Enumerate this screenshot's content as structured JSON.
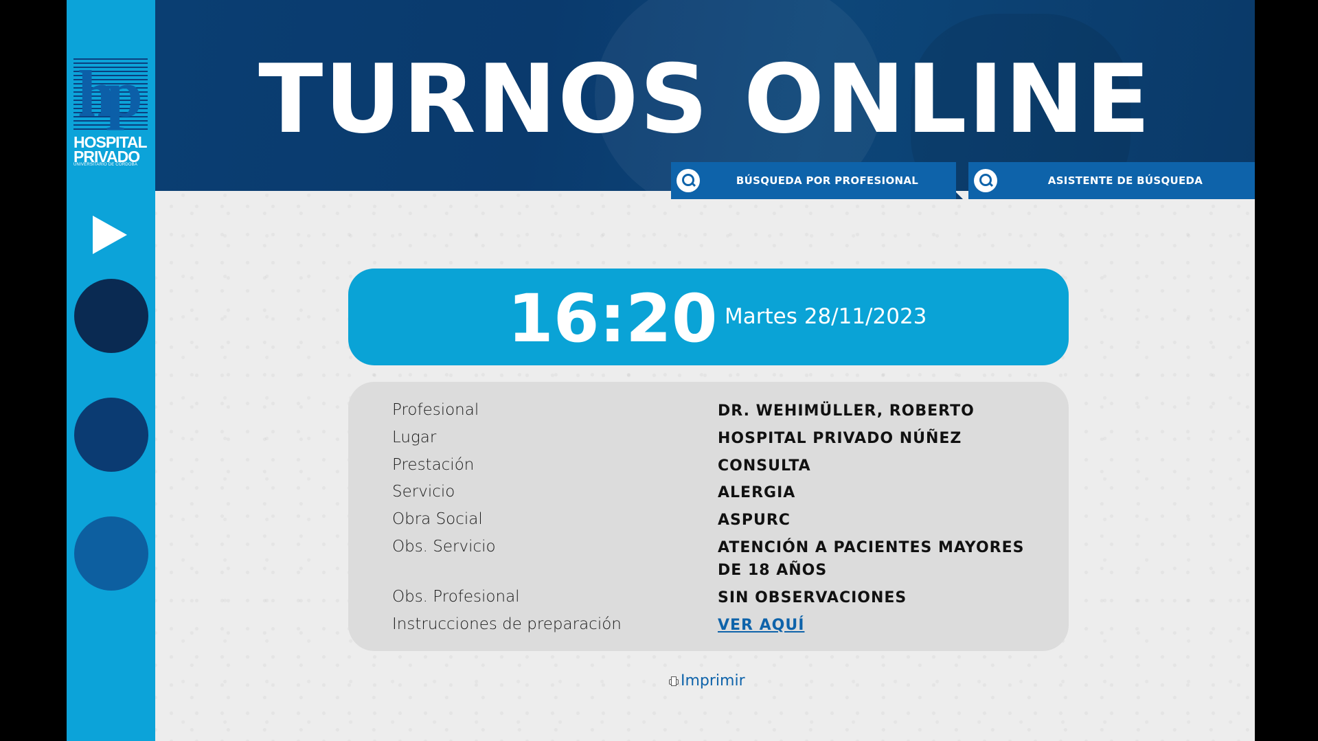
{
  "sidebar": {
    "logo_letters": "hp",
    "logo_line1": "HOSPITAL",
    "logo_line2": "PRIVADO",
    "logo_sub": "UNIVERSITARIO DE CÓRDOBA",
    "play_icon": "play-icon",
    "dots": [
      {
        "name": "slide-dot-1",
        "color": "#0a2a52"
      },
      {
        "name": "slide-dot-2",
        "color": "#0b3b72"
      },
      {
        "name": "slide-dot-3",
        "color": "#0d5fa0"
      }
    ],
    "color": "#0ca3d9"
  },
  "header": {
    "title": "TURNOS ONLINE",
    "buttons": [
      {
        "label": "BÚSQUEDA POR PROFESIONAL",
        "icon": "search-icon"
      },
      {
        "label": "ASISTENTE DE BÚSQUEDA",
        "icon": "search-icon"
      }
    ],
    "button_color": "#0e63aa"
  },
  "appointment": {
    "time": "16:20",
    "date": "Martes 28/11/2023",
    "details": [
      {
        "label": "Profesional",
        "value": "DR. WEHIMÜLLER, ROBERTO"
      },
      {
        "label": "Lugar",
        "value": "HOSPITAL PRIVADO NÚÑEZ"
      },
      {
        "label": "Prestación",
        "value": "CONSULTA"
      },
      {
        "label": "Servicio",
        "value": "ALERGIA"
      },
      {
        "label": "Obra Social",
        "value": "ASPURC"
      },
      {
        "label": "Obs. Servicio",
        "value": "ATENCIÓN A PACIENTES MAYORES DE 18 AÑOS"
      },
      {
        "label": "Obs. Profesional",
        "value": "SIN OBSERVACIONES"
      },
      {
        "label": "Instrucciones de preparación",
        "value": "VER AQUÍ"
      }
    ]
  },
  "print": {
    "label": "Imprimir",
    "icon": "printer-icon"
  }
}
